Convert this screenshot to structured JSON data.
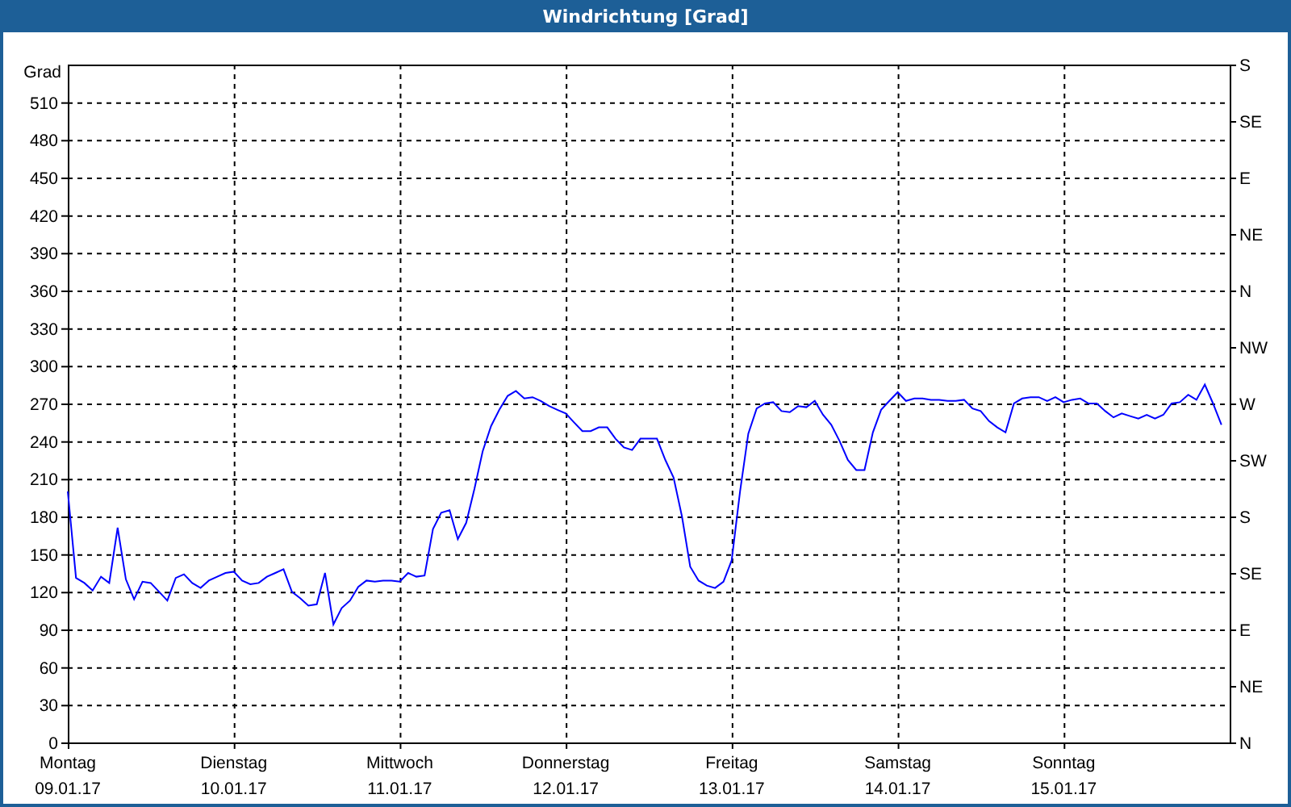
{
  "window": {
    "title": "Windrichtung [Grad]"
  },
  "chart": {
    "chart_data": {
      "type": "line",
      "grid": true,
      "ylabel": "Grad",
      "ylim": [
        0,
        540
      ],
      "yticks": [
        0,
        30,
        60,
        90,
        120,
        150,
        180,
        210,
        240,
        270,
        300,
        330,
        360,
        390,
        420,
        450,
        480,
        510
      ],
      "categories": [
        "Montag",
        null,
        null,
        null,
        null,
        null,
        null,
        null,
        null,
        null,
        null,
        null,
        null,
        null,
        null,
        null,
        null,
        null,
        null,
        null,
        "Dienstag",
        null,
        null,
        null,
        null,
        null,
        null,
        null,
        null,
        null,
        null,
        null,
        null,
        null,
        null,
        null,
        null,
        null,
        null,
        null,
        "Mittwoch",
        null,
        null,
        null,
        null,
        null,
        null,
        null,
        null,
        null,
        null,
        null,
        null,
        null,
        null,
        null,
        null,
        null,
        null,
        null,
        "Donnerstag",
        null,
        null,
        null,
        null,
        null,
        null,
        null,
        null,
        null,
        null,
        null,
        null,
        null,
        null,
        null,
        null,
        null,
        null,
        null,
        "Freitag",
        null,
        null,
        null,
        null,
        null,
        null,
        null,
        null,
        null,
        null,
        null,
        null,
        null,
        null,
        null,
        null,
        null,
        null,
        null,
        "Samstag",
        null,
        null,
        null,
        null,
        null,
        null,
        null,
        null,
        null,
        null,
        null,
        null,
        null,
        null,
        null,
        null,
        null,
        null,
        null,
        "Sonntag",
        null,
        null,
        null,
        null,
        null,
        null,
        null,
        null,
        null,
        null,
        null,
        null,
        null,
        null,
        null,
        null,
        null,
        null,
        null
      ],
      "series": [
        {
          "color": "#0000ff",
          "values": [
            200,
            131,
            127,
            121,
            132,
            127,
            171,
            130,
            114,
            128,
            127,
            120,
            113,
            131,
            134,
            127,
            123,
            129,
            132,
            135,
            136,
            129,
            126,
            127,
            132,
            135,
            138,
            120,
            115,
            109,
            110,
            135,
            94,
            107,
            113,
            124,
            129,
            128,
            129,
            129,
            128,
            135,
            132,
            133,
            170,
            183,
            185,
            162,
            175,
            202,
            232,
            252,
            265,
            276,
            280,
            274,
            275,
            272,
            268,
            265,
            262,
            255,
            248,
            248,
            251,
            251,
            242,
            235,
            233,
            242,
            242,
            242,
            225,
            211,
            180,
            140,
            129,
            125,
            123,
            128,
            145,
            200,
            246,
            266,
            270,
            271,
            264,
            263,
            268,
            267,
            272,
            261,
            253,
            240,
            225,
            217,
            217,
            247,
            265,
            272,
            279,
            272,
            274,
            274,
            273,
            273,
            272,
            272,
            273,
            266,
            264,
            256,
            251,
            247,
            270,
            274,
            275,
            275,
            272,
            275,
            271,
            273,
            274,
            270,
            270,
            264,
            259,
            262,
            260,
            258,
            261,
            258,
            261,
            270,
            271,
            277,
            273,
            285,
            270,
            253
          ]
        }
      ]
    },
    "x_axis_dates": [
      "09.01.17",
      "10.01.17",
      "11.01.17",
      "12.01.17",
      "13.01.17",
      "14.01.17",
      "15.01.17"
    ],
    "compass_axis_labels": [
      "S",
      "SE",
      "E",
      "NE",
      "N",
      "NW",
      "W",
      "SW",
      "S",
      "SE",
      "E",
      "NE",
      "N"
    ]
  }
}
